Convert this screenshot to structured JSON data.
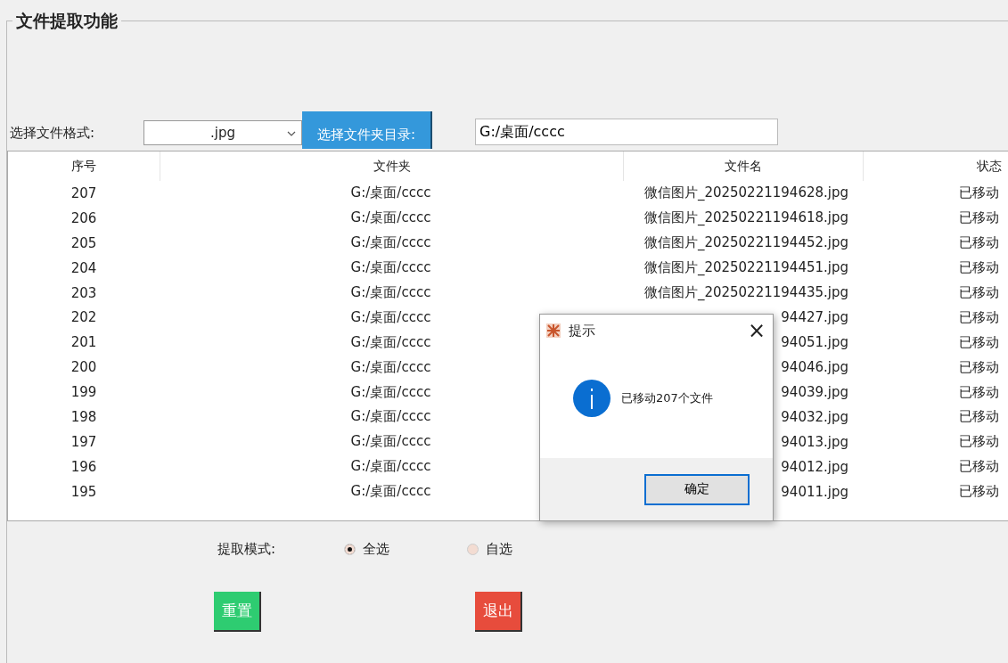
{
  "group_title": "文件提取功能",
  "format": {
    "label": "选择文件格式:",
    "value": ".jpg"
  },
  "folder_button": "选择文件夹目录:",
  "folder_path": "G:/桌面/cccc",
  "table": {
    "columns": [
      "序号",
      "文件夹",
      "文件名",
      "状态"
    ],
    "rows": [
      {
        "no": "207",
        "folder": "G:/桌面/cccc",
        "file": "微信图片_20250221194628.jpg",
        "status": "已移动"
      },
      {
        "no": "206",
        "folder": "G:/桌面/cccc",
        "file": "微信图片_20250221194618.jpg",
        "status": "已移动"
      },
      {
        "no": "205",
        "folder": "G:/桌面/cccc",
        "file": "微信图片_20250221194452.jpg",
        "status": "已移动"
      },
      {
        "no": "204",
        "folder": "G:/桌面/cccc",
        "file": "微信图片_20250221194451.jpg",
        "status": "已移动"
      },
      {
        "no": "203",
        "folder": "G:/桌面/cccc",
        "file": "微信图片_20250221194435.jpg",
        "status": "已移动"
      },
      {
        "no": "202",
        "folder": "G:/桌面/cccc",
        "file": "94427.jpg",
        "status": "已移动"
      },
      {
        "no": "201",
        "folder": "G:/桌面/cccc",
        "file": "94051.jpg",
        "status": "已移动"
      },
      {
        "no": "200",
        "folder": "G:/桌面/cccc",
        "file": "94046.jpg",
        "status": "已移动"
      },
      {
        "no": "199",
        "folder": "G:/桌面/cccc",
        "file": "94039.jpg",
        "status": "已移动"
      },
      {
        "no": "198",
        "folder": "G:/桌面/cccc",
        "file": "94032.jpg",
        "status": "已移动"
      },
      {
        "no": "197",
        "folder": "G:/桌面/cccc",
        "file": "94013.jpg",
        "status": "已移动"
      },
      {
        "no": "196",
        "folder": "G:/桌面/cccc",
        "file": "94012.jpg",
        "status": "已移动"
      },
      {
        "no": "195",
        "folder": "G:/桌面/cccc",
        "file": "94011.jpg",
        "status": "已移动"
      }
    ]
  },
  "mode": {
    "label": "提取模式:",
    "options": [
      {
        "label": "全选",
        "selected": true
      },
      {
        "label": "自选",
        "selected": false
      }
    ]
  },
  "buttons": [
    {
      "label": "重置",
      "kind": "reset"
    },
    {
      "label": "退出",
      "kind": "exit"
    }
  ],
  "dialog": {
    "title": "提示",
    "close": "×",
    "message": "已移动207个文件",
    "ok": "确定"
  }
}
